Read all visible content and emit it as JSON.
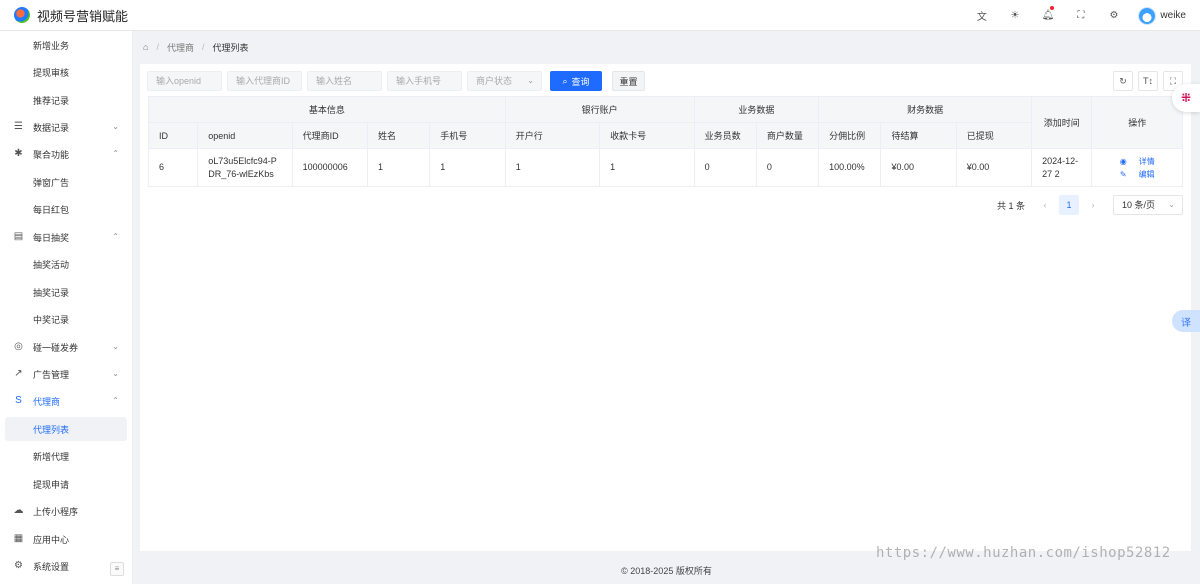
{
  "header": {
    "app_title": "视频号营销赋能",
    "icons": [
      "translate-icon",
      "theme-icon",
      "bell-icon",
      "fullscreen-icon",
      "settings-icon"
    ],
    "user_name": "weike"
  },
  "sidebar": {
    "items": [
      {
        "label": "新增业务",
        "type": "sub"
      },
      {
        "label": "提现审核",
        "type": "sub"
      },
      {
        "label": "推荐记录",
        "type": "sub"
      },
      {
        "label": "数据记录",
        "type": "parent",
        "icon": "list-icon",
        "expanded": false
      },
      {
        "label": "聚合功能",
        "type": "parent",
        "icon": "bug-icon",
        "expanded": true
      },
      {
        "label": "弹窗广告",
        "type": "sub"
      },
      {
        "label": "每日红包",
        "type": "sub"
      },
      {
        "label": "每日抽奖",
        "type": "parent",
        "icon": "calendar-icon",
        "expanded": true
      },
      {
        "label": "抽奖活动",
        "type": "sub"
      },
      {
        "label": "抽奖记录",
        "type": "sub"
      },
      {
        "label": "中奖记录",
        "type": "sub"
      },
      {
        "label": "碰一碰发券",
        "type": "parent",
        "icon": "play-circle-icon",
        "expanded": false
      },
      {
        "label": "广告管理",
        "type": "parent",
        "icon": "share-icon",
        "expanded": false
      },
      {
        "label": "代理商",
        "type": "parent",
        "icon": "agent-icon",
        "expanded": true,
        "highlight": true
      },
      {
        "label": "代理列表",
        "type": "sub",
        "active": true
      },
      {
        "label": "新增代理",
        "type": "sub"
      },
      {
        "label": "提现申请",
        "type": "sub"
      },
      {
        "label": "上传小程序",
        "type": "parent",
        "icon": "cloud-upload-icon"
      },
      {
        "label": "应用中心",
        "type": "parent",
        "icon": "grid-icon"
      },
      {
        "label": "系统设置",
        "type": "parent",
        "icon": "gear-icon"
      }
    ]
  },
  "breadcrumb": {
    "items": [
      "代理商",
      "代理列表"
    ]
  },
  "filters": {
    "openid_placeholder": "输入openid",
    "agent_id_placeholder": "输入代理商ID",
    "name_placeholder": "输入姓名",
    "phone_placeholder": "输入手机号",
    "status_placeholder": "商户状态",
    "search_label": "查询",
    "reset_label": "重置"
  },
  "table": {
    "groups": [
      "基本信息",
      "银行账户",
      "业务数据",
      "财务数据",
      "添加时间",
      "操作"
    ],
    "columns": [
      "ID",
      "openid",
      "代理商ID",
      "姓名",
      "手机号",
      "开户行",
      "收款卡号",
      "业务员数",
      "商户数量",
      "分佣比例",
      "待结算",
      "已提现"
    ],
    "rows": [
      {
        "id": "6",
        "openid": "oL73u5Elcfc94-PDR_76-wlEzKbs",
        "agent_id": "100000006",
        "name": "1",
        "phone": "1",
        "bank": "1",
        "card": "1",
        "staff": "0",
        "merchants": "0",
        "ratio": "100.00%",
        "pending": "¥0.00",
        "withdrawn": "¥0.00",
        "created": "2024-12-27 2",
        "detail_label": "详情",
        "edit_label": "编辑"
      }
    ]
  },
  "pagination": {
    "total_text": "共 1 条",
    "current_page": "1",
    "page_size": "10 条/页"
  },
  "footer": {
    "copyright": "© 2018-2025 版权所有"
  },
  "watermark": "https://www.huzhan.com/ishop52812",
  "colors": {
    "primary": "#1f6bff",
    "bg": "#f0f2f5"
  }
}
